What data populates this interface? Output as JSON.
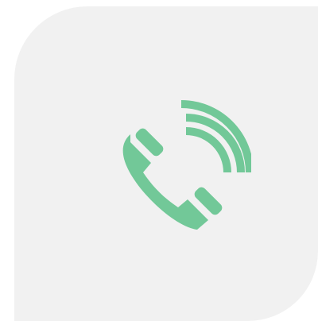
{
  "icon": {
    "name": "phone-call-icon",
    "color": "#72c898"
  },
  "tile": {
    "background": "#f1f1f1"
  }
}
